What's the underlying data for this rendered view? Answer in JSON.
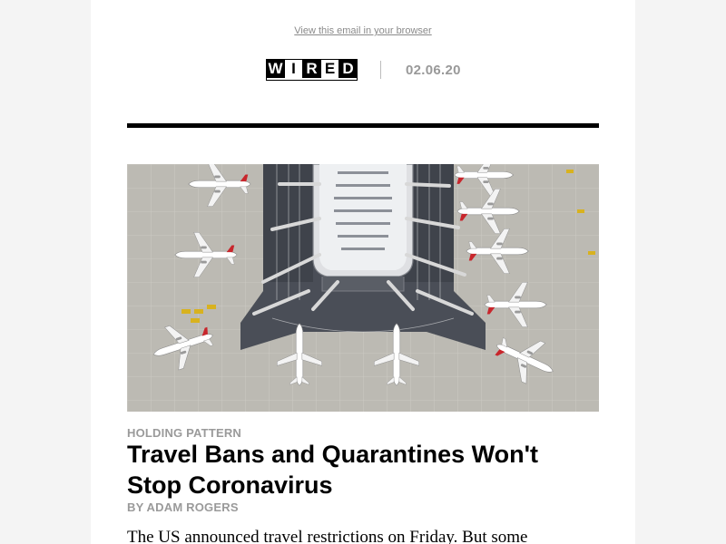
{
  "header": {
    "view_in_browser": "View this email in your browser",
    "logo_letters": [
      "W",
      "I",
      "R",
      "E",
      "D"
    ],
    "date": "02.06.20"
  },
  "article": {
    "image_alt": "Airport terminal with airplanes parked at gates",
    "kicker": "HOLDING PATTERN",
    "headline": "Travel Bans and Quarantines Won't Stop Coronavirus",
    "byline": "BY ADAM ROGERS",
    "dek": "The US announced travel restrictions on Friday. But some"
  },
  "colors": {
    "page_background": "#f4f4f4",
    "email_background": "#ffffff",
    "muted_text": "#999999",
    "rule": "#000000",
    "tarmac": "#b9b7b0",
    "terminal_roof": "#e9eaec",
    "airplane": "#ffffff",
    "airline_red": "#c8262c"
  }
}
